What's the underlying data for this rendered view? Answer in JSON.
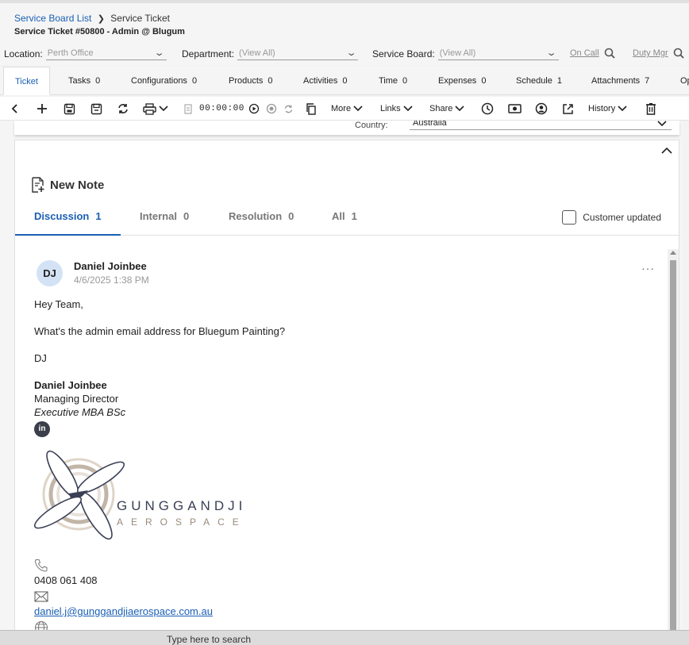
{
  "header": {
    "breadcrumb": {
      "parent": "Service Board List",
      "current": "Service Ticket"
    },
    "title": "Service Ticket #50800 - Admin @ Blugum"
  },
  "filters": {
    "location_label": "Location:",
    "location_value": "Perth Office",
    "department_label": "Department:",
    "department_value": "(View All)",
    "service_board_label": "Service Board:",
    "service_board_value": "(View All)",
    "on_call": "On Call",
    "duty_mgr": "Duty Mgr"
  },
  "tabs": [
    {
      "label": "Ticket",
      "count": ""
    },
    {
      "label": "Tasks",
      "count": "0"
    },
    {
      "label": "Configurations",
      "count": "0"
    },
    {
      "label": "Products",
      "count": "0"
    },
    {
      "label": "Activities",
      "count": "0"
    },
    {
      "label": "Time",
      "count": "0"
    },
    {
      "label": "Expenses",
      "count": "0"
    },
    {
      "label": "Schedule",
      "count": "1"
    },
    {
      "label": "Attachments",
      "count": "7"
    },
    {
      "label": "Op",
      "count": ""
    }
  ],
  "toolbar": {
    "timer": "00:00:00",
    "more": "More",
    "links": "Links",
    "share": "Share",
    "history": "History"
  },
  "country": {
    "label": "Country:",
    "value": "Australia"
  },
  "notes": {
    "new_note_label": "New Note",
    "tabs": [
      {
        "label": "Discussion",
        "count": "1"
      },
      {
        "label": "Internal",
        "count": "0"
      },
      {
        "label": "Resolution",
        "count": "0"
      },
      {
        "label": "All",
        "count": "1"
      }
    ],
    "customer_updated_label": "Customer updated",
    "customer_updated_checked": false
  },
  "note": {
    "initials": "DJ",
    "author": "Daniel Joinbee",
    "timestamp": "4/6/2025 1:38 PM",
    "more": "···",
    "greeting": "Hey Team,",
    "question": "What's the admin email address for Bluegum Painting?",
    "signoff": "DJ",
    "signature": {
      "name": "Daniel Joinbee",
      "role": "Managing Director",
      "qualifications": "Executive MBA BSc",
      "linkedin": "in",
      "company_name": "GUNGGANDJI",
      "company_sub": "AEROSPACE",
      "phone": "0408 061 408",
      "email": "daniel.j@gunggandjiaerospace.com.au"
    }
  },
  "taskbar": {
    "search_placeholder": "Type here to search"
  },
  "colors": {
    "accent": "#1a5fb4",
    "logo_dark": "#3a3f56",
    "logo_tan": "#9a8b7a"
  }
}
